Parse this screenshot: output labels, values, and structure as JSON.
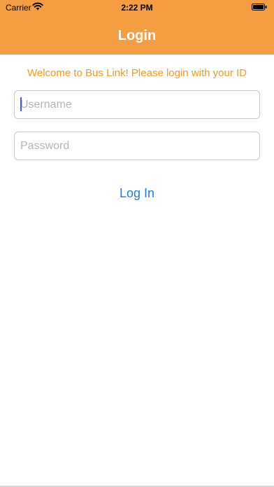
{
  "status_bar": {
    "carrier": "Carrier",
    "time": "2:22 PM",
    "wifi_icon": "wifi-icon",
    "battery_icon": "battery-icon"
  },
  "header": {
    "title": "Login",
    "color": "#f49d43"
  },
  "welcome": {
    "text": "Welcome to Bus Link! Please login with your ID",
    "color": "#f39a1f"
  },
  "form": {
    "username_placeholder": "Username",
    "username_value": "",
    "password_placeholder": "Password",
    "password_value": "",
    "login_label": "Log In",
    "link_color": "#1f7be8"
  }
}
